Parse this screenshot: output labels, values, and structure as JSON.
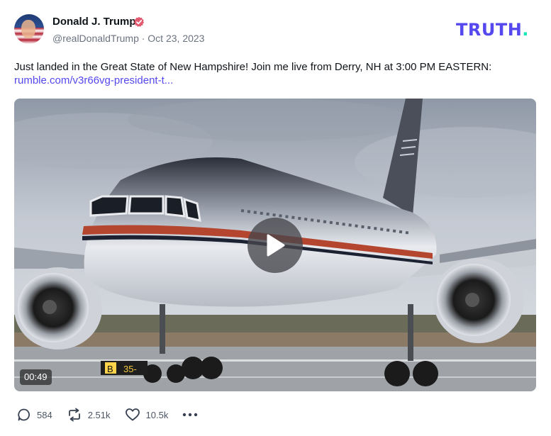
{
  "author": {
    "display_name": "Donald J. Trump",
    "handle_line": "@realDonaldTrump · Oct 23, 2023",
    "verified": true
  },
  "brand": {
    "name": "TRUTH",
    "dot": ".",
    "color": "#5448ee",
    "dot_color": "#17e7b6"
  },
  "post": {
    "text": "Just landed in the Great State of New Hampshire! Join me live from Derry, NH at 3:00 PM EASTERN:",
    "link_text": "rumble.com/v3r66vg-president-t...",
    "link_color": "#5448ee"
  },
  "media": {
    "type": "video",
    "duration": "00:49",
    "tail_registration_text": "B 35-"
  },
  "actions": {
    "replies": "584",
    "retruths": "2.51k",
    "likes": "10.5k"
  },
  "icons": {
    "verified": "verified-badge-icon",
    "reply": "comment-icon",
    "retruth": "retruth-icon",
    "like": "heart-icon",
    "more": "more-icon",
    "play": "play-icon"
  }
}
